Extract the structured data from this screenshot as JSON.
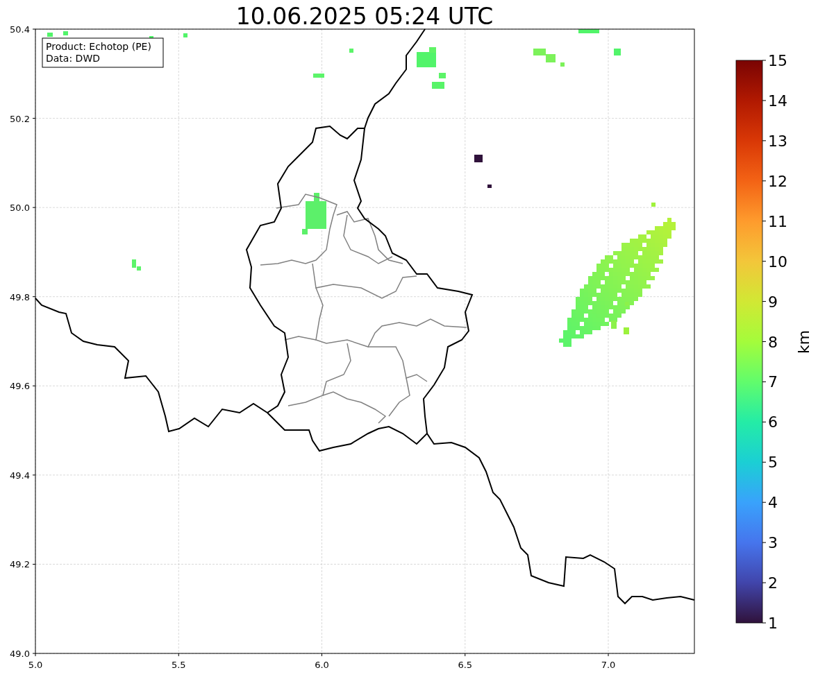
{
  "title": "10.06.2025 05:24 UTC",
  "legend": {
    "lines": [
      "Product: Echotop (PE)",
      "Data: DWD"
    ]
  },
  "x_ticks": [
    "5.0",
    "5.5",
    "6.0",
    "6.5",
    "7.0"
  ],
  "y_ticks": [
    "50.4",
    "50.2",
    "50.0",
    "49.8",
    "49.6",
    "49.4",
    "49.2",
    "49.0"
  ],
  "colorbar": {
    "label": "km",
    "ticks": [
      "15",
      "14",
      "13",
      "12",
      "11",
      "10",
      "9",
      "8",
      "7",
      "6",
      "5",
      "4",
      "3",
      "2",
      "1"
    ]
  }
}
